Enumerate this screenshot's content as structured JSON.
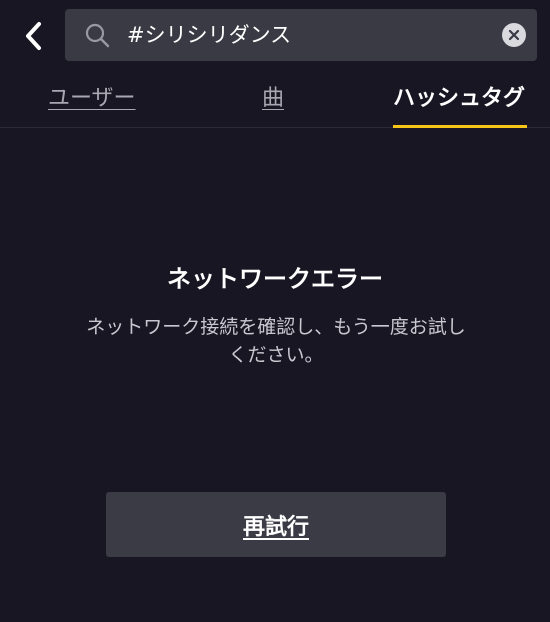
{
  "header": {
    "back_icon": "chevron-left-icon",
    "search": {
      "icon": "search-icon",
      "value": "#シリシリダンス",
      "clear_icon": "clear-icon"
    }
  },
  "tabs": [
    {
      "label": "ユーザー",
      "active": false
    },
    {
      "label": "曲",
      "active": false
    },
    {
      "label": "ハッシュタグ",
      "active": true
    }
  ],
  "error": {
    "title": "ネットワークエラー",
    "message": "ネットワーク接続を確認し、もう一度お試しください。",
    "retry_label": "再試行"
  },
  "colors": {
    "background": "#171622",
    "search_bg": "#3a3a44",
    "accent": "#f5c518",
    "button_bg": "#3b3b45"
  }
}
